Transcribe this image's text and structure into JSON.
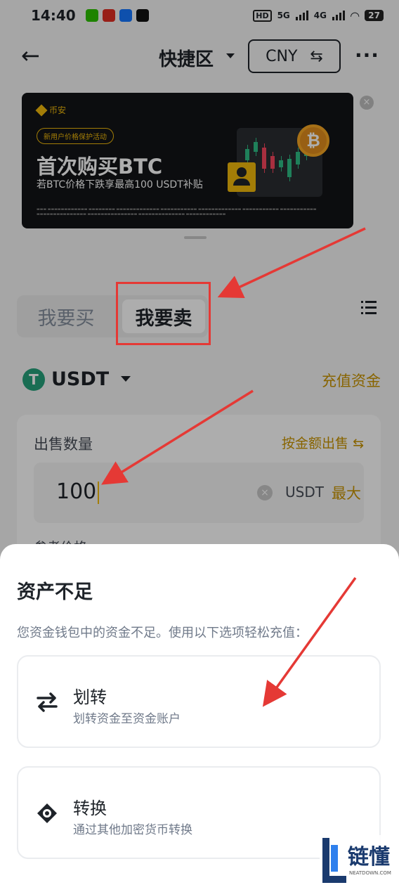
{
  "status_bar": {
    "time": "14:40",
    "network_badge": "HD",
    "signal_label": "5G",
    "signal_label_2": "4G",
    "battery": "27"
  },
  "nav": {
    "title": "快捷区",
    "currency": "CNY"
  },
  "banner": {
    "brand": "币安",
    "pill": "新用户价格保护活动",
    "headline": "首次购买BTC",
    "subtitle": "若BTC价格下跌享最高100 USDT补贴",
    "coin_symbol": "₿"
  },
  "trade_tabs": {
    "buy": "我要买",
    "sell": "我要卖"
  },
  "asset": {
    "symbol": "USDT",
    "logo_glyph": "T",
    "deposit_link": "充值资金"
  },
  "sell_form": {
    "label": "出售数量",
    "toggle": "按金额出售 ⇆",
    "amount": "100",
    "unit": "USDT",
    "max": "最大",
    "price_label": "参考价格"
  },
  "sheet": {
    "title": "资产不足",
    "description": "您资金钱包中的资金不足。使用以下选项轻松充值：",
    "options": [
      {
        "title": "划转",
        "subtitle": "划转资金至资金账户"
      },
      {
        "title": "转换",
        "subtitle": "通过其他加密货币转换"
      }
    ]
  },
  "watermark": {
    "text": "链懂",
    "sub": "NEATDOWN.COM"
  },
  "colors": {
    "accent": "#c99400",
    "annotation": "#e53935",
    "usdt": "#26a17b"
  }
}
